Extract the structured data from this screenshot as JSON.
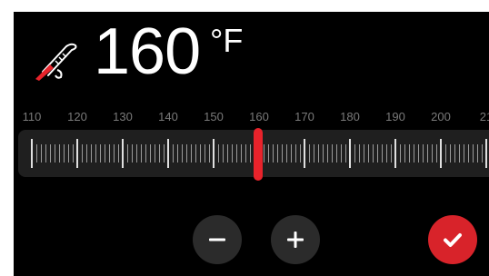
{
  "display": {
    "temperature_value": "160",
    "temperature_unit": "°F",
    "icon": "probe-thermometer-icon"
  },
  "scale": {
    "labels": [
      "110",
      "120",
      "130",
      "140",
      "150",
      "160",
      "170",
      "180",
      "190",
      "200",
      "21"
    ],
    "min": 110,
    "step": 10,
    "current": 160,
    "unit": "°F"
  },
  "controls": {
    "decrease_icon": "minus-icon",
    "increase_icon": "plus-icon",
    "confirm_icon": "checkmark-icon"
  },
  "colors": {
    "accent": "#e8232b",
    "background": "#000000",
    "track": "#1f1f1f",
    "button": "#2b2b2b",
    "label": "#7a7a7a"
  }
}
